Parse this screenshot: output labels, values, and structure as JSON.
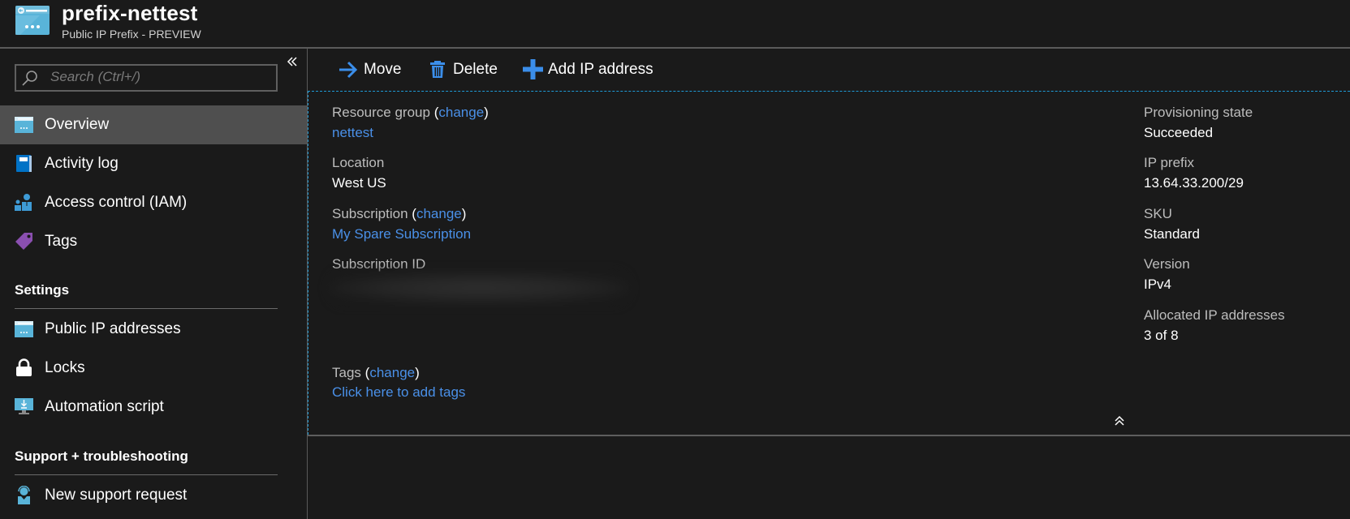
{
  "header": {
    "title": "prefix-nettest",
    "subtitle": "Public IP Prefix - PREVIEW",
    "icon": "public-ip-prefix-icon"
  },
  "sidebar": {
    "search": {
      "placeholder": "Search (Ctrl+/)",
      "value": ""
    },
    "collapse_icon": "double-chevron-left-icon",
    "items": [
      {
        "label": "Overview",
        "icon": "overview-icon",
        "active": true
      },
      {
        "label": "Activity log",
        "icon": "activity-log-icon"
      },
      {
        "label": "Access control (IAM)",
        "icon": "iam-icon"
      },
      {
        "label": "Tags",
        "icon": "tag-icon"
      }
    ],
    "sections": [
      {
        "title": "Settings",
        "items": [
          {
            "label": "Public IP addresses",
            "icon": "public-ip-icon"
          },
          {
            "label": "Locks",
            "icon": "lock-icon"
          },
          {
            "label": "Automation script",
            "icon": "automation-script-icon"
          }
        ]
      },
      {
        "title": "Support + troubleshooting",
        "items": [
          {
            "label": "New support request",
            "icon": "support-request-icon"
          }
        ]
      }
    ]
  },
  "toolbar": {
    "move_label": "Move",
    "delete_label": "Delete",
    "add_ip_label": "Add IP address"
  },
  "essentials": {
    "left": {
      "resource_group": {
        "label": "Resource group",
        "change": "change",
        "value": "nettest"
      },
      "location": {
        "label": "Location",
        "value": "West US"
      },
      "subscription": {
        "label": "Subscription",
        "change": "change",
        "value": "My Spare Subscription"
      },
      "subscription_id": {
        "label": "Subscription ID",
        "value": ""
      },
      "tags": {
        "label": "Tags",
        "change": "change",
        "value": "Click here to add tags"
      }
    },
    "right": {
      "provisioning_state": {
        "label": "Provisioning state",
        "value": "Succeeded"
      },
      "ip_prefix": {
        "label": "IP prefix",
        "value": "13.64.33.200/29"
      },
      "sku": {
        "label": "SKU",
        "value": "Standard"
      },
      "version": {
        "label": "Version",
        "value": "IPv4"
      },
      "allocated": {
        "label": "Allocated IP addresses",
        "value": "3 of 8"
      }
    },
    "collapse_icon": "double-chevron-up-icon"
  },
  "colors": {
    "background": "#1a1a1a",
    "link": "#4a90e8",
    "accent_icon": "#3b8eea",
    "active_nav": "#4f4f4f",
    "dashed_border": "#1e9ad6"
  }
}
